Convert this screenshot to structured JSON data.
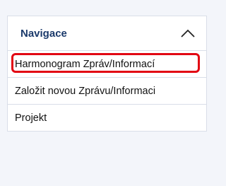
{
  "navigation": {
    "title": "Navigace",
    "toggle_icon": "chevron-up-icon",
    "items": [
      {
        "label": "Harmonogram Zpráv/Informací",
        "highlighted": true
      },
      {
        "label": "Založit novou Zprávu/Informaci",
        "highlighted": false
      },
      {
        "label": "Projekt",
        "highlighted": false
      }
    ]
  },
  "colors": {
    "title": "#1b3a6b",
    "highlight_border": "#e20613",
    "border": "#d9dee8",
    "background": "#f3f5fa"
  }
}
